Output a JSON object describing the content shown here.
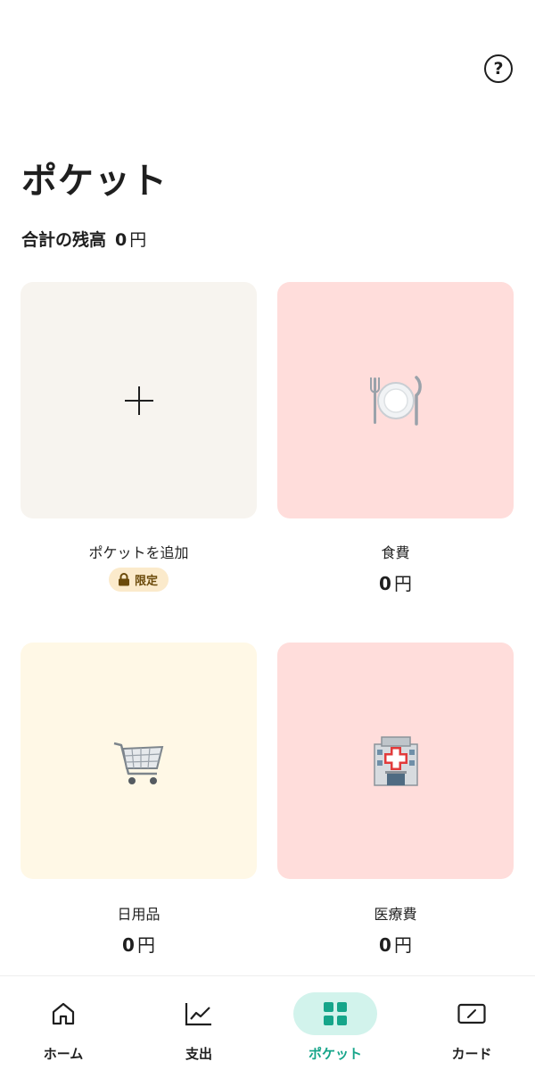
{
  "header": {
    "help_icon": "question-circle-icon",
    "help_glyph": "?"
  },
  "page_title": "ポケット",
  "total": {
    "label": "合計の残高",
    "amount": "0",
    "unit": "円"
  },
  "pockets": [
    {
      "kind": "add",
      "label": "ポケットを追加",
      "badge": "限定",
      "badge_icon": "lock-icon",
      "color": "#f7f4ef"
    },
    {
      "label": "食費",
      "amount": "0",
      "unit": "円",
      "icon": "fork-knife-plate-icon",
      "color": "#ffdddb"
    },
    {
      "label": "日用品",
      "amount": "0",
      "unit": "円",
      "icon": "shopping-cart-icon",
      "color": "#fff8e6"
    },
    {
      "label": "医療費",
      "amount": "0",
      "unit": "円",
      "icon": "hospital-icon",
      "color": "#ffdddb"
    }
  ],
  "nav": [
    {
      "label": "ホーム",
      "icon": "home-icon"
    },
    {
      "label": "支出",
      "icon": "chart-icon"
    },
    {
      "label": "ポケット",
      "icon": "grid-icon",
      "active": true
    },
    {
      "label": "カード",
      "icon": "card-icon"
    }
  ],
  "colors": {
    "accent": "#16a58a",
    "accent_bg": "#d2f3ec",
    "badge_bg": "#fbeacb"
  }
}
